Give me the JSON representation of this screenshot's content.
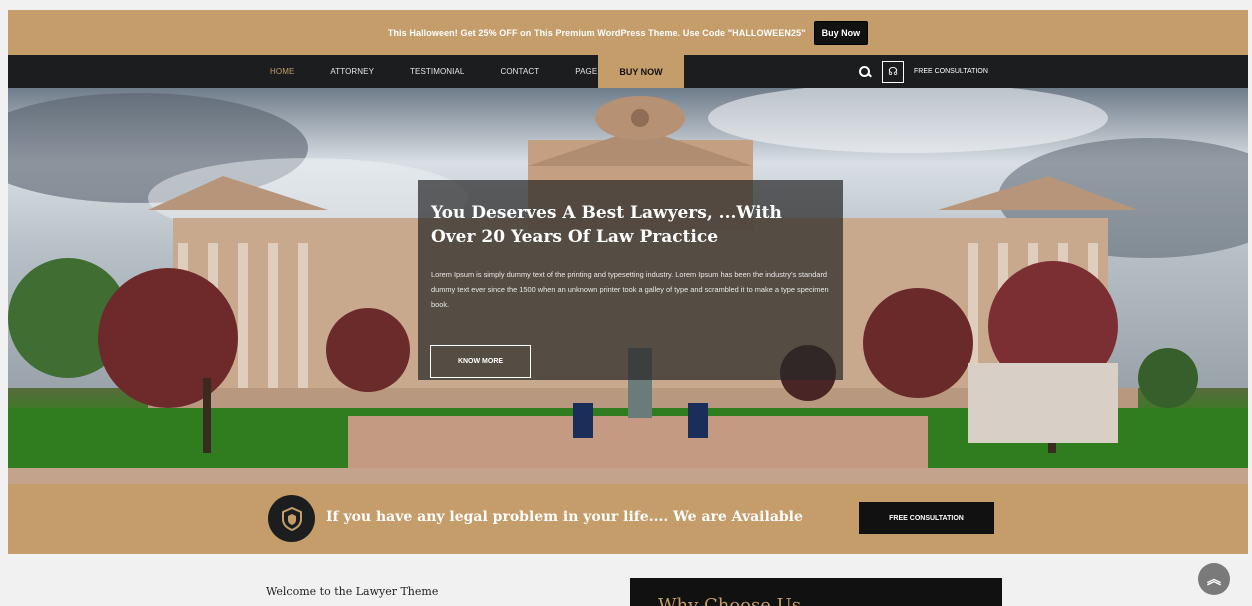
{
  "promo": {
    "text": "This Halloween! Get 25% OFF on This Premium WordPress Theme. Use Code \"HALLOWEEN25\"",
    "button": "Buy Now"
  },
  "nav": {
    "items": [
      {
        "label": "Home",
        "active": true
      },
      {
        "label": "Attorney"
      },
      {
        "label": "Testimonial"
      },
      {
        "label": "Contact"
      },
      {
        "label": "Page"
      }
    ],
    "buy_now": "BUY NOW",
    "consultation": "FREE CONSULTATION"
  },
  "hero": {
    "title": "You Deserves A Best Lawyers, ...With Over 20 Years Of Law Practice",
    "text": "Lorem Ipsum is simply dummy text of the printing and typesetting industry. Lorem Ipsum has been the industry's standard dummy text ever since the 1500 when an unknown printer took a galley of type and scrambled it to make a type specimen book.",
    "button": "KNOW MORE"
  },
  "cta": {
    "text": "If you have any legal problem in your life.... We are Available",
    "button": "FREE CONSULTATION"
  },
  "welcome": {
    "title": "Welcome to the Lawyer Theme"
  },
  "why": {
    "title": "Why Choose Us"
  },
  "colors": {
    "accent": "#c59d6b",
    "dark": "#1b1d1f"
  }
}
